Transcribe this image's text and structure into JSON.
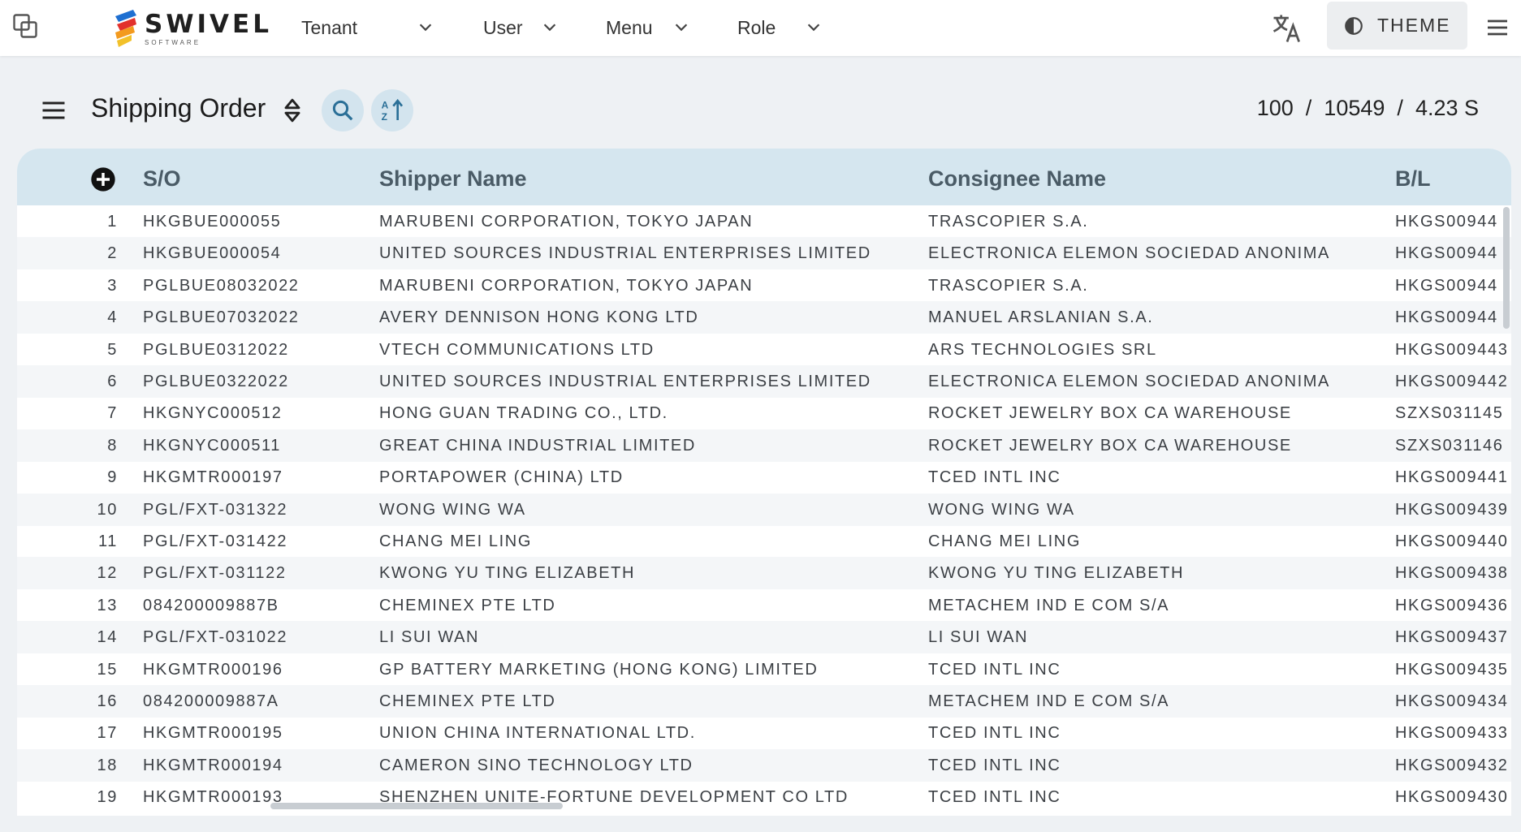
{
  "topbar": {
    "logo_text": "SWIVEL",
    "logo_sub": "SOFTWARE",
    "menus": [
      {
        "label": "Tenant"
      },
      {
        "label": "User"
      },
      {
        "label": "Menu"
      },
      {
        "label": "Role"
      }
    ],
    "theme_label": "THEME"
  },
  "page": {
    "title": "Shipping Order",
    "shown_count": "100",
    "total_count": "10549",
    "load_time": "4.23 S",
    "separator": "/"
  },
  "table": {
    "columns": {
      "so": "S/O",
      "shipper": "Shipper Name",
      "consignee": "Consignee Name",
      "bl": "B/L"
    },
    "rows": [
      {
        "num": "1",
        "so": "HKGBUE000055",
        "shipper": "MARUBENI CORPORATION, TOKYO JAPAN",
        "consignee": "TRASCOPIER S.A.",
        "bl": "HKGS00944"
      },
      {
        "num": "2",
        "so": "HKGBUE000054",
        "shipper": "UNITED SOURCES INDUSTRIAL ENTERPRISES LIMITED",
        "consignee": "ELECTRONICA ELEMON SOCIEDAD ANONIMA",
        "bl": "HKGS00944"
      },
      {
        "num": "3",
        "so": "PGLBUE08032022",
        "shipper": "MARUBENI CORPORATION, TOKYO JAPAN",
        "consignee": "TRASCOPIER S.A.",
        "bl": "HKGS00944"
      },
      {
        "num": "4",
        "so": "PGLBUE07032022",
        "shipper": "AVERY DENNISON HONG KONG LTD",
        "consignee": "MANUEL ARSLANIAN S.A.",
        "bl": "HKGS00944"
      },
      {
        "num": "5",
        "so": "PGLBUE0312022",
        "shipper": "VTECH COMMUNICATIONS LTD",
        "consignee": "ARS TECHNOLOGIES SRL",
        "bl": "HKGS009443"
      },
      {
        "num": "6",
        "so": "PGLBUE0322022",
        "shipper": "UNITED SOURCES INDUSTRIAL ENTERPRISES LIMITED",
        "consignee": "ELECTRONICA ELEMON SOCIEDAD ANONIMA",
        "bl": "HKGS009442"
      },
      {
        "num": "7",
        "so": "HKGNYC000512",
        "shipper": "HONG GUAN TRADING CO., LTD.",
        "consignee": "ROCKET JEWELRY BOX CA WAREHOUSE",
        "bl": "SZXS031145"
      },
      {
        "num": "8",
        "so": "HKGNYC000511",
        "shipper": "GREAT CHINA INDUSTRIAL LIMITED",
        "consignee": "ROCKET JEWELRY BOX CA WAREHOUSE",
        "bl": "SZXS031146"
      },
      {
        "num": "9",
        "so": "HKGMTR000197",
        "shipper": "PORTAPOWER (CHINA) LTD",
        "consignee": "TCED INTL INC",
        "bl": "HKGS009441"
      },
      {
        "num": "10",
        "so": "PGL/FXT-031322",
        "shipper": "WONG WING WA",
        "consignee": "WONG WING WA",
        "bl": "HKGS009439"
      },
      {
        "num": "11",
        "so": "PGL/FXT-031422",
        "shipper": "CHANG MEI LING",
        "consignee": "CHANG MEI LING",
        "bl": "HKGS009440"
      },
      {
        "num": "12",
        "so": "PGL/FXT-031122",
        "shipper": "KWONG YU TING ELIZABETH",
        "consignee": "KWONG YU TING ELIZABETH",
        "bl": "HKGS009438"
      },
      {
        "num": "13",
        "so": "084200009887B",
        "shipper": "CHEMINEX PTE LTD",
        "consignee": "METACHEM IND E COM S/A",
        "bl": "HKGS009436"
      },
      {
        "num": "14",
        "so": "PGL/FXT-031022",
        "shipper": "LI SUI WAN",
        "consignee": "LI SUI WAN",
        "bl": "HKGS009437"
      },
      {
        "num": "15",
        "so": "HKGMTR000196",
        "shipper": "GP BATTERY MARKETING (HONG KONG) LIMITED",
        "consignee": "TCED INTL INC",
        "bl": "HKGS009435"
      },
      {
        "num": "16",
        "so": "084200009887A",
        "shipper": "CHEMINEX PTE LTD",
        "consignee": "METACHEM IND E COM S/A",
        "bl": "HKGS009434"
      },
      {
        "num": "17",
        "so": "HKGMTR000195",
        "shipper": "UNION CHINA INTERNATIONAL LTD.",
        "consignee": "TCED INTL INC",
        "bl": "HKGS009433"
      },
      {
        "num": "18",
        "so": "HKGMTR000194",
        "shipper": "CAMERON SINO TECHNOLOGY LTD",
        "consignee": "TCED INTL INC",
        "bl": "HKGS009432"
      },
      {
        "num": "19",
        "so": "HKGMTR000193",
        "shipper": "SHENZHEN UNITE-FORTUNE DEVELOPMENT CO LTD",
        "consignee": "TCED INTL INC",
        "bl": "HKGS009430"
      }
    ]
  }
}
